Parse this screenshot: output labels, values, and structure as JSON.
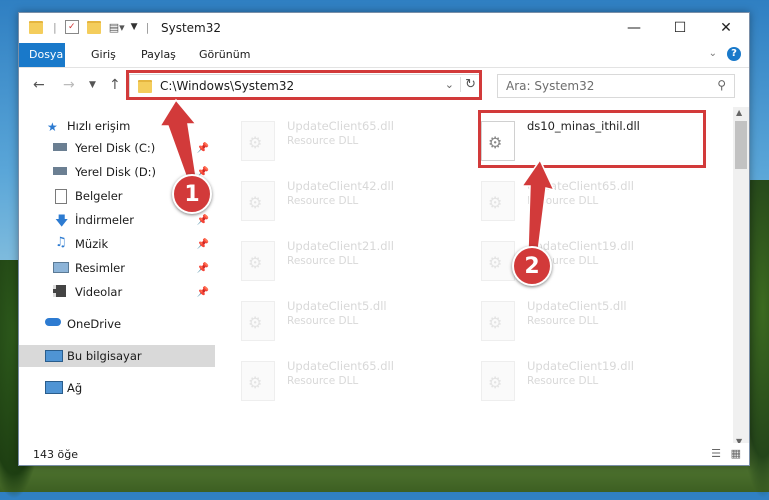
{
  "window": {
    "title": "System32"
  },
  "ribbon": {
    "tabs": [
      "Dosya",
      "Giriş",
      "Paylaş",
      "Görünüm"
    ]
  },
  "address": {
    "path": "C:\\Windows\\System32",
    "search_placeholder": "Ara: System32"
  },
  "nav": {
    "items": [
      {
        "label": "Hızlı erişim",
        "icon": "star-icon"
      },
      {
        "label": "Yerel Disk (C:)",
        "icon": "drive-icon",
        "pinned": true
      },
      {
        "label": "Yerel Disk (D:)",
        "icon": "drive-icon",
        "pinned": true
      },
      {
        "label": "Belgeler",
        "icon": "documents-icon"
      },
      {
        "label": "İndirmeler",
        "icon": "download-icon",
        "pinned": true
      },
      {
        "label": "Müzik",
        "icon": "music-icon",
        "pinned": true
      },
      {
        "label": "Resimler",
        "icon": "pictures-icon",
        "pinned": true
      },
      {
        "label": "Videolar",
        "icon": "video-icon",
        "pinned": true
      },
      {
        "label": "OneDrive",
        "icon": "cloud-icon"
      },
      {
        "label": "Bu bilgisayar",
        "icon": "computer-icon",
        "selected": true
      },
      {
        "label": "Ağ",
        "icon": "network-icon"
      }
    ]
  },
  "files": [
    {
      "name": "UpdateClient65.dll",
      "type": "Resource DLL"
    },
    {
      "name": "ds10_minas_ithil.dll",
      "type": ""
    },
    {
      "name": "UpdateClient42.dll",
      "type": "Resource DLL"
    },
    {
      "name": "UpdateClient65.dll",
      "type": "Resource DLL"
    },
    {
      "name": "UpdateClient21.dll",
      "type": "Resource DLL"
    },
    {
      "name": "UpdateClient19.dll",
      "type": "Resource DLL"
    },
    {
      "name": "UpdateClient5.dll",
      "type": "Resource DLL"
    },
    {
      "name": "UpdateClient5.dll",
      "type": "Resource DLL"
    },
    {
      "name": "UpdateClient65.dll",
      "type": "Resource DLL"
    },
    {
      "name": "UpdateClient19.dll",
      "type": "Resource DLL"
    }
  ],
  "status": {
    "count": "143 öğe"
  },
  "callouts": [
    "1",
    "2"
  ],
  "colors": {
    "accent": "#1979ca",
    "highlight": "#d23a3a"
  }
}
